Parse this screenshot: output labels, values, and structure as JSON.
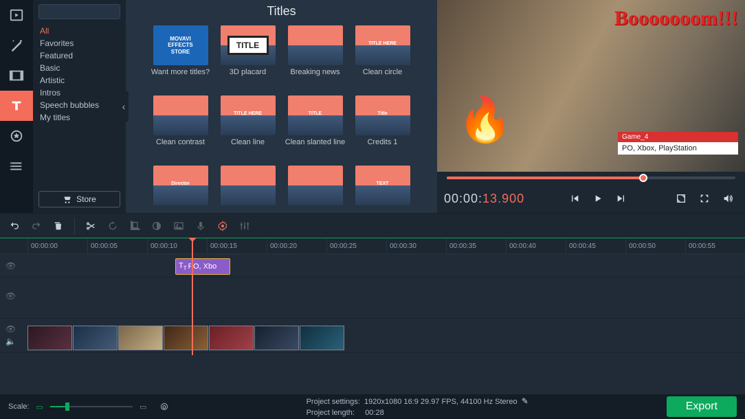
{
  "sidebar": {
    "tools": [
      "media",
      "wand",
      "filters",
      "titles",
      "stickers",
      "more"
    ]
  },
  "categories": {
    "search_placeholder": "",
    "items": [
      "All",
      "Favorites",
      "Featured",
      "Basic",
      "Artistic",
      "Intros",
      "Speech bubbles",
      "My titles"
    ],
    "active_index": 0,
    "store_label": "Store"
  },
  "gallery": {
    "title": "Titles",
    "items": [
      {
        "label": "Want more titles?",
        "skin": "store",
        "txt": "MOVAVI\nEFFECTS\nSTORE"
      },
      {
        "label": "3D placard",
        "skin": "placard",
        "txt": "TITLE"
      },
      {
        "label": "Breaking news",
        "skin": "mount",
        "txt": ""
      },
      {
        "label": "Clean circle",
        "skin": "mount",
        "txt": "TITLE HERE"
      },
      {
        "label": "Clean contrast",
        "skin": "mount",
        "txt": ""
      },
      {
        "label": "Clean line",
        "skin": "mount",
        "txt": "TITLE HERE"
      },
      {
        "label": "Clean slanted line",
        "skin": "mount",
        "txt": "TITLE"
      },
      {
        "label": "Credits 1",
        "skin": "mount",
        "txt": "Title"
      },
      {
        "label": "",
        "skin": "mount",
        "txt": "Director"
      },
      {
        "label": "",
        "skin": "mount",
        "txt": ""
      },
      {
        "label": "",
        "skin": "mount",
        "txt": ""
      },
      {
        "label": "",
        "skin": "mount",
        "txt": "TEXT"
      }
    ]
  },
  "preview": {
    "boom": "Booooooom!!!",
    "lower_third_top": "Game_4",
    "lower_third_bottom": "PO, Xbox, PlayStation",
    "timecode_prefix": "00:00:",
    "timecode_value": "13.900",
    "progress_pct": 68
  },
  "ruler": [
    "00:00:00",
    "00:00:05",
    "00:00:10",
    "00:00:15",
    "00:00:20",
    "00:00:25",
    "00:00:30",
    "00:00:35",
    "00:00:40",
    "00:00:45",
    "00:00:50",
    "00:00:55"
  ],
  "title_clip": {
    "label": "PO, Xbo"
  },
  "footer": {
    "scale_label": "Scale:",
    "settings_label": "Project settings:",
    "settings_value": "1920x1080 16:9 29.97 FPS, 44100 Hz Stereo",
    "length_label": "Project length:",
    "length_value": "00:28",
    "export_label": "Export"
  }
}
